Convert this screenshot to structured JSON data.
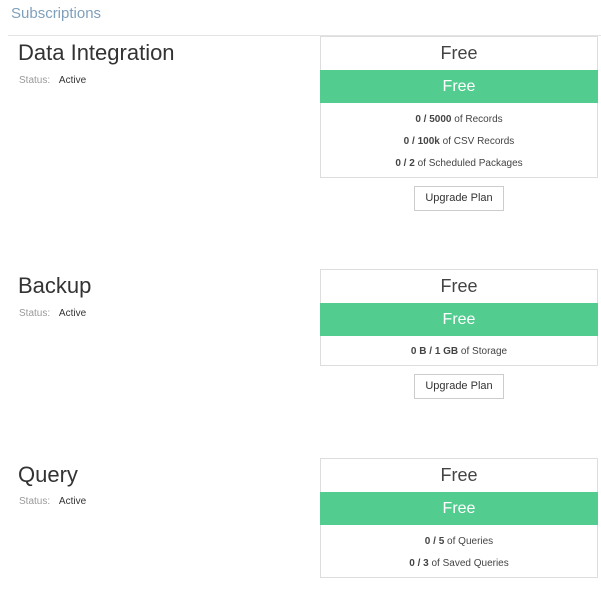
{
  "page": {
    "title": "Subscriptions"
  },
  "subscriptions": [
    {
      "name": "Data Integration",
      "status_label": "Status:",
      "status_value": "Active",
      "plan_title": "Free",
      "plan_banner": "Free",
      "quotas": [
        {
          "used": "0",
          "sep": " / ",
          "limit": "5000",
          "suffix": " of Records"
        },
        {
          "used": "0",
          "sep": " / ",
          "limit": "100k",
          "suffix": " of CSV Records"
        },
        {
          "used": "0",
          "sep": " / ",
          "limit": "2",
          "suffix": " of Scheduled Packages"
        }
      ],
      "upgrade_label": "Upgrade Plan"
    },
    {
      "name": "Backup",
      "status_label": "Status:",
      "status_value": "Active",
      "plan_title": "Free",
      "plan_banner": "Free",
      "quotas": [
        {
          "used": "0 B",
          "sep": " / ",
          "limit": "1 GB",
          "suffix": " of Storage"
        }
      ],
      "upgrade_label": "Upgrade Plan"
    },
    {
      "name": "Query",
      "status_label": "Status:",
      "status_value": "Active",
      "plan_title": "Free",
      "plan_banner": "Free",
      "quotas": [
        {
          "used": "0",
          "sep": " / ",
          "limit": "5",
          "suffix": " of Queries"
        },
        {
          "used": "0",
          "sep": " / ",
          "limit": "3",
          "suffix": " of Saved Queries"
        }
      ]
    }
  ],
  "colors": {
    "title": "#7fa0bd",
    "plan_banner": "#52cd8f",
    "card_border": "#dddddd"
  }
}
